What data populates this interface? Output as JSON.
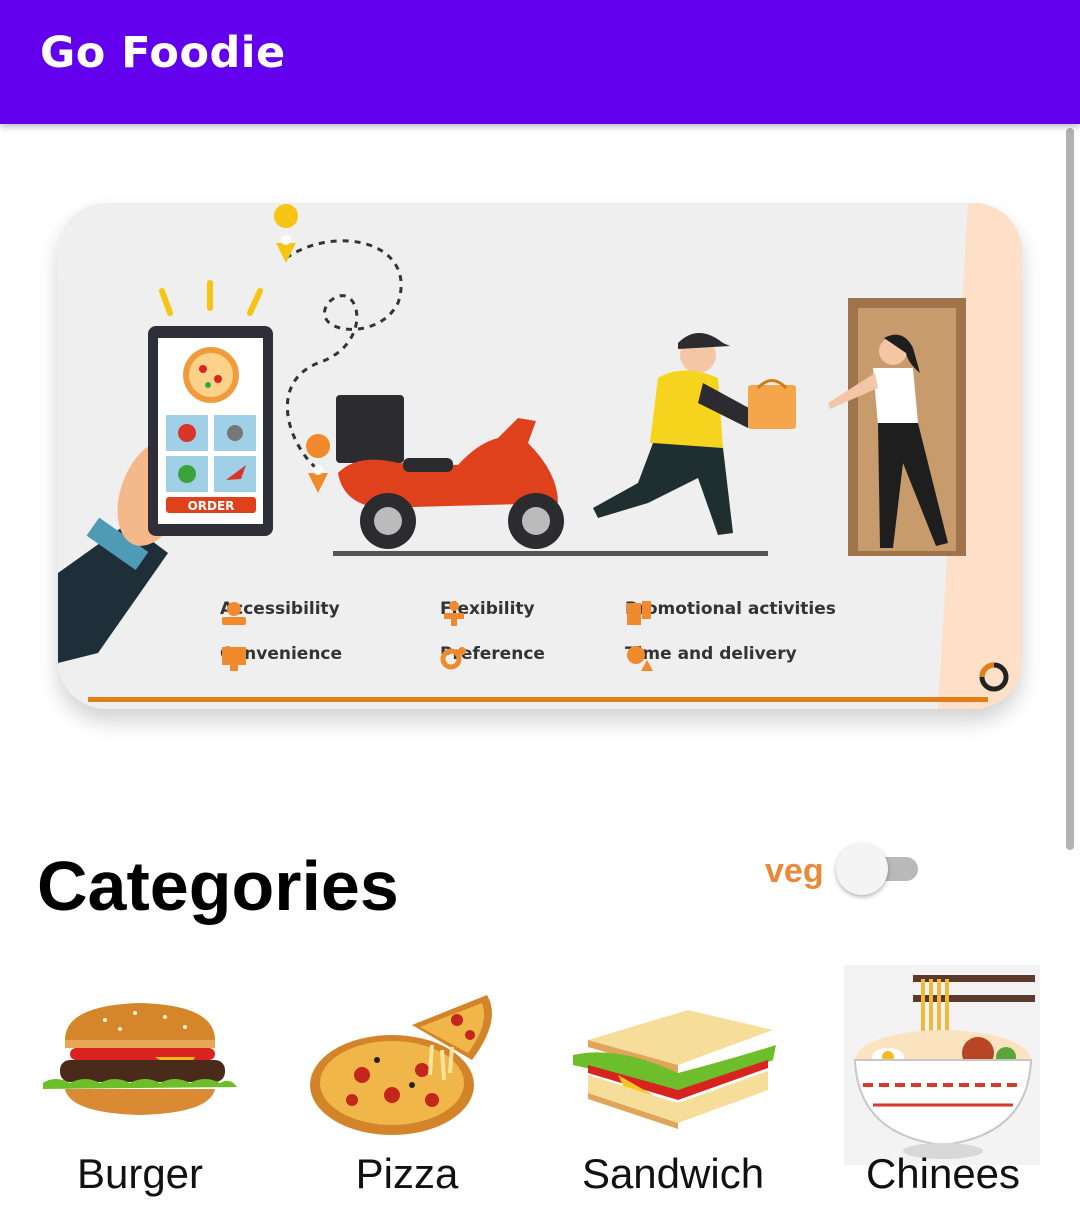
{
  "app": {
    "title": "Go Foodie"
  },
  "banner": {
    "order_label": "ORDER",
    "features": [
      "Accessibility",
      "Flexibility",
      "Promotional activities",
      "Convenience",
      "Preference",
      "Time and delivery"
    ]
  },
  "categories": {
    "heading": "Categories",
    "veg_label": "veg",
    "veg_toggle_on": false,
    "items": [
      {
        "label": "Burger",
        "icon": "burger-image"
      },
      {
        "label": "Pizza",
        "icon": "pizza-image"
      },
      {
        "label": "Sandwich",
        "icon": "sandwich-image"
      },
      {
        "label": "Chinees",
        "icon": "noodle-bowl-image"
      }
    ]
  },
  "colors": {
    "app_bar": "#6200ee",
    "accent_orange": "#e9893a",
    "scooter_red": "#e0411d"
  }
}
